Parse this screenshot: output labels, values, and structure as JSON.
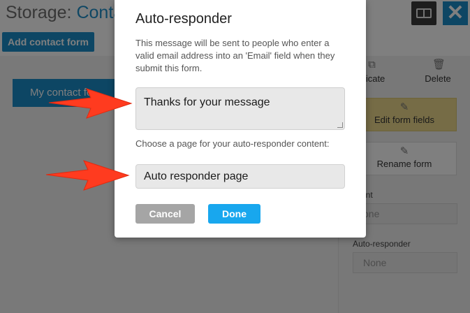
{
  "colors": {
    "brand_blue": "#1a8cc8",
    "done_blue": "#18a7ee",
    "cancel_gray": "#a5a5a5",
    "edit_yellow": "#ecd98c",
    "arrow_red": "#ff3b1f"
  },
  "header": {
    "title_prefix": "Storage: ",
    "title_accent": "Conta",
    "layout_icon": "columns-icon",
    "close_icon": "close-icon",
    "add_button": "Add contact form"
  },
  "forms": [
    {
      "label": "My contact fo"
    }
  ],
  "sidebar": {
    "duplicate_label": "plicate",
    "duplicate_icon": "duplicate-icon",
    "delete_label": "Delete",
    "delete_icon": "trash-icon",
    "edit_fields_label": "Edit form fields",
    "edit_fields_icon": "pencil-icon",
    "rename_label": "Rename form",
    "rename_icon": "pencil-icon",
    "recipient_label": "ipient",
    "recipient_value": "one",
    "autoresponder_label": "Auto-responder",
    "autoresponder_value": "None"
  },
  "modal": {
    "title": "Auto-responder",
    "description": "This message will be sent to people who enter a valid email address into an 'Email' field when they submit this form.",
    "message_value": "Thanks for your message",
    "page_prompt": "Choose a page for your auto-responder content:",
    "page_value": "Auto responder page",
    "cancel_label": "Cancel",
    "done_label": "Done"
  }
}
